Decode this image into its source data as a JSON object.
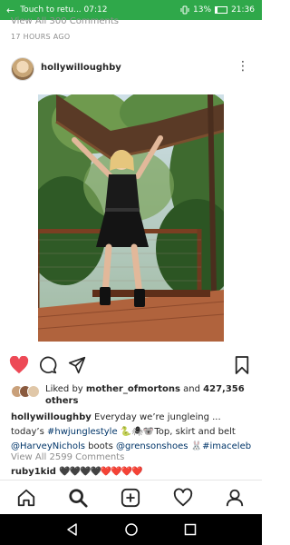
{
  "status_bar": {
    "back_glyph": "←",
    "call_text": "Touch to retu... 07:12",
    "battery": "13%",
    "time": "21:36",
    "icons": [
      "vibrate-icon",
      "battery-icon"
    ]
  },
  "post": {
    "previous_comments": "View All 300 Comments",
    "timestamp": "17 HOURS AGO",
    "username": "hollywilloughby",
    "more_glyph": "⋮",
    "likes": {
      "liked_by_prefix": "Liked by ",
      "liked_by_user": "mother_ofmortons",
      "and": " and ",
      "count": "427,356",
      "others": "others"
    },
    "caption": {
      "username": "hollywilloughby",
      "text1": " Everyday we’re jungleing ... today’s ",
      "hashtag1": "#hwjunglestyle",
      "emojis": " 🐍🕷🐨",
      "text2": "Top, skirt and belt ",
      "mention1": "@HarveyNichols",
      "text3": " boots ",
      "mention2": "@grensonshoes",
      "text4": " 🐰",
      "hashtag2": "#imaceleb"
    },
    "view_all_comments": "View All 2599 Comments",
    "comment": {
      "user": "ruby1kid",
      "hearts": "🖤🖤🖤🖤❤️❤️❤️❤️"
    }
  },
  "colors": {
    "status_bar": "#2fa84a",
    "like_red": "#ed4956",
    "link_blue": "#003569",
    "muted": "#8e8e8e"
  },
  "tab_bar": [
    "home-icon",
    "search-icon",
    "add-post-icon",
    "activity-icon",
    "profile-icon"
  ],
  "system_nav": [
    "back-icon",
    "home-circle-icon",
    "recents-icon"
  ]
}
